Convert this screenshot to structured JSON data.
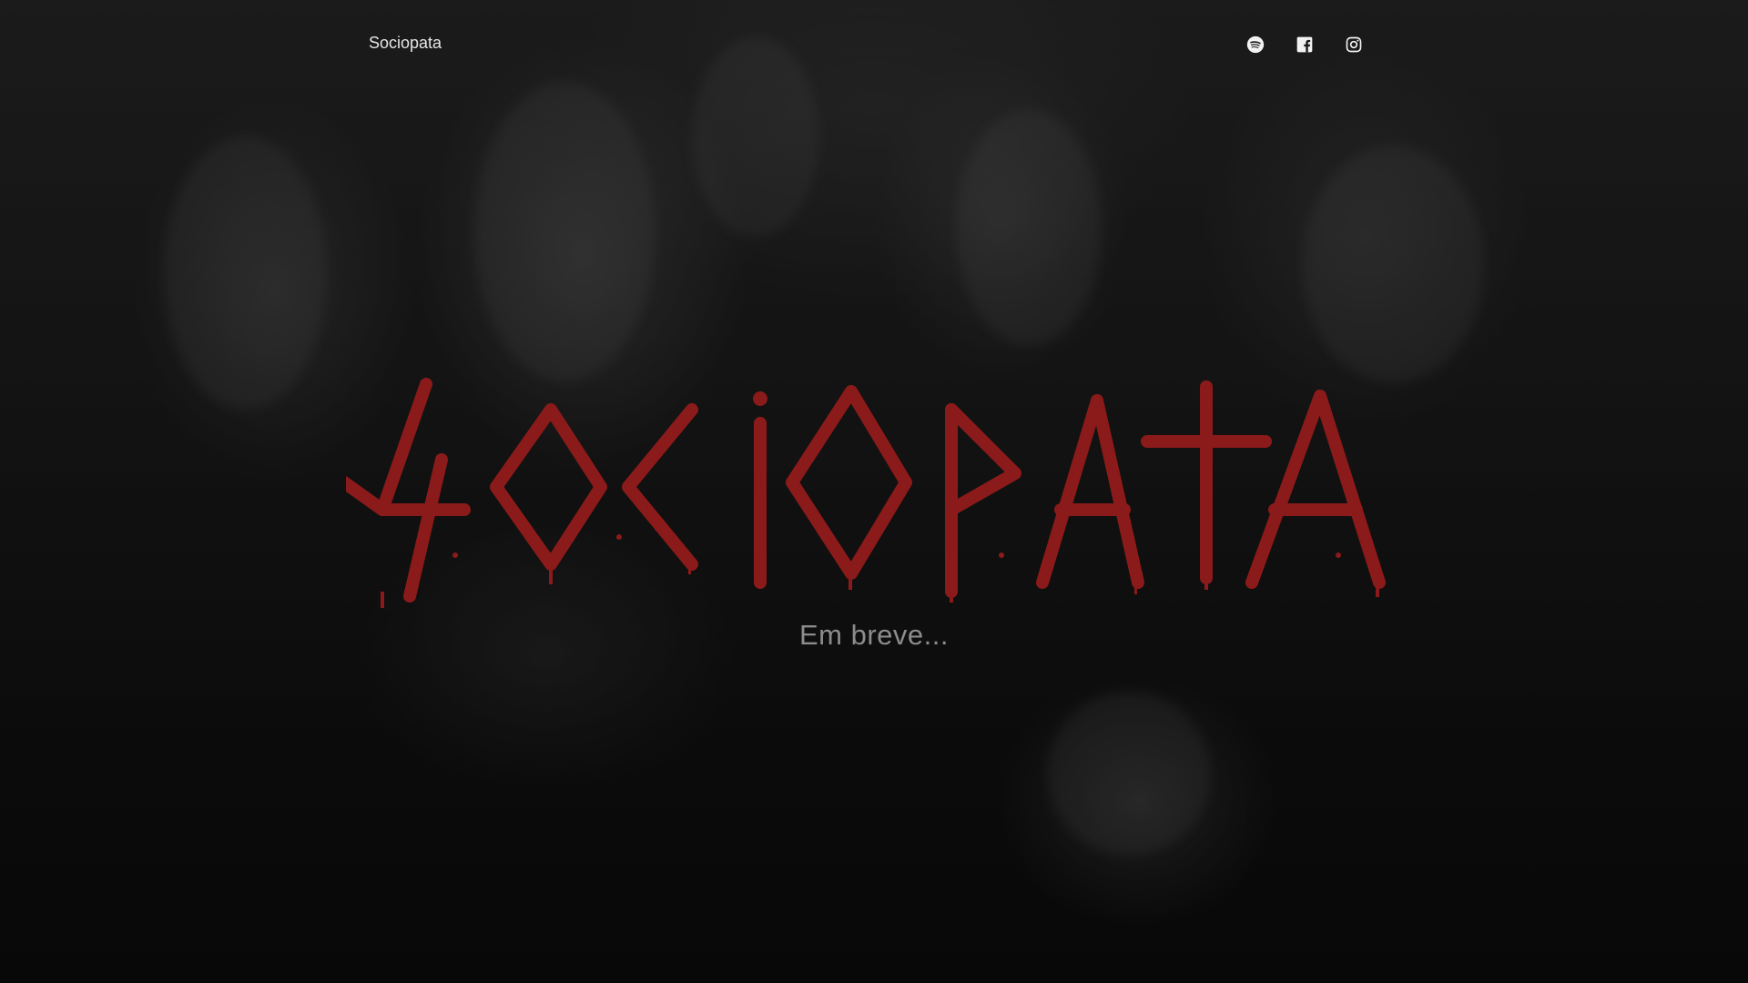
{
  "navbar": {
    "brand": "Sociopata",
    "social": [
      {
        "name": "spotify",
        "icon": "spotify-icon"
      },
      {
        "name": "facebook",
        "icon": "facebook-icon"
      },
      {
        "name": "instagram",
        "icon": "instagram-icon"
      }
    ]
  },
  "hero": {
    "logo_text": "SOCIOPATA",
    "logo_color": "#8b1a1a",
    "tagline": "Em breve..."
  }
}
